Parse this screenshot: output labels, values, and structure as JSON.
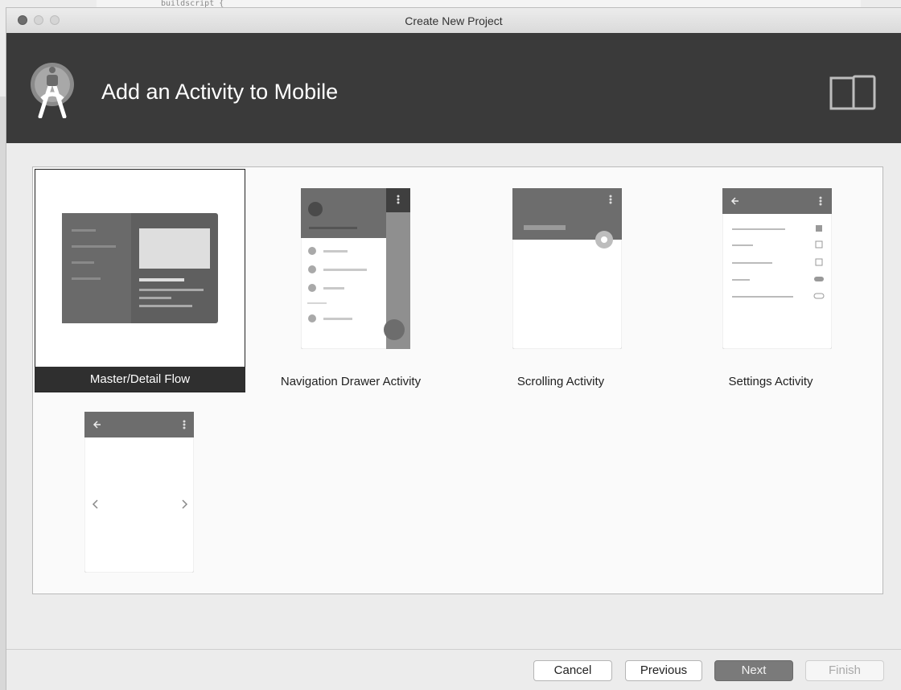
{
  "window": {
    "title": "Create New Project"
  },
  "header": {
    "title": "Add an Activity to Mobile"
  },
  "background": {
    "code_peek": "buildscript {"
  },
  "gallery": {
    "items": [
      {
        "label": "Master/Detail Flow",
        "selected": true
      },
      {
        "label": "Navigation Drawer Activity",
        "selected": false
      },
      {
        "label": "Scrolling Activity",
        "selected": false
      },
      {
        "label": "Settings Activity",
        "selected": false
      },
      {
        "label": "",
        "selected": false
      }
    ]
  },
  "footer": {
    "cancel": "Cancel",
    "previous": "Previous",
    "next": "Next",
    "finish": "Finish"
  },
  "colors": {
    "header_bg": "#3a3a3a",
    "selected_label_bg": "#2f2f2f",
    "thumb_dark": "#5f5f5f"
  }
}
